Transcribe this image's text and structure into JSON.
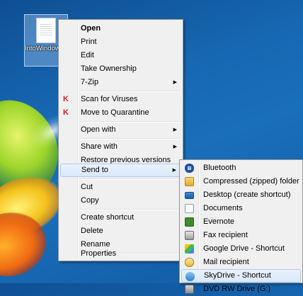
{
  "desktop": {
    "file_icon_label": "IntoWindows.txt"
  },
  "context_menu": {
    "items": [
      {
        "label": "Open"
      },
      {
        "label": "Print"
      },
      {
        "label": "Edit"
      },
      {
        "label": "Take Ownership"
      },
      {
        "label": "7-Zip"
      },
      {
        "label": "Scan for Viruses"
      },
      {
        "label": "Move to Quarantine"
      },
      {
        "label": "Open with"
      },
      {
        "label": "Share with"
      },
      {
        "label": "Restore previous versions"
      },
      {
        "label": "Send to"
      },
      {
        "label": "Cut"
      },
      {
        "label": "Copy"
      },
      {
        "label": "Create shortcut"
      },
      {
        "label": "Delete"
      },
      {
        "label": "Rename"
      },
      {
        "label": "Properties"
      }
    ],
    "submenu_arrow": "▶",
    "kaspersky_icon": "K"
  },
  "send_to_menu": {
    "items": [
      {
        "label": "Bluetooth",
        "icon": "bluetooth-icon"
      },
      {
        "label": "Compressed (zipped) folder",
        "icon": "zip-folder-icon"
      },
      {
        "label": "Desktop (create shortcut)",
        "icon": "desktop-icon"
      },
      {
        "label": "Documents",
        "icon": "documents-icon"
      },
      {
        "label": "Evernote",
        "icon": "evernote-icon"
      },
      {
        "label": "Fax recipient",
        "icon": "fax-icon"
      },
      {
        "label": "Google Drive - Shortcut",
        "icon": "google-drive-icon"
      },
      {
        "label": "Mail recipient",
        "icon": "mail-icon"
      },
      {
        "label": "SkyDrive - Shortcut",
        "icon": "skydrive-icon"
      },
      {
        "label": "DVD RW Drive (G:)",
        "icon": "dvd-drive-icon"
      }
    ]
  },
  "colors": {
    "menu_bg": "#f0f0f0",
    "highlight": "#d9e8fb",
    "highlight_border": "#aeccf1",
    "desktop_blue": "#1768b3"
  }
}
